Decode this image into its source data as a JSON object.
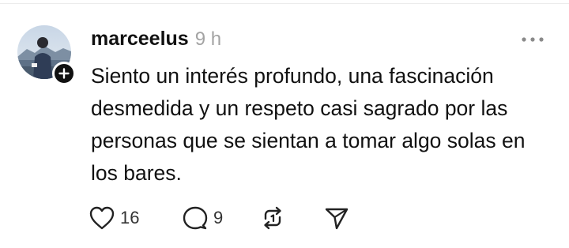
{
  "post": {
    "username": "marceelus",
    "time": "9 h",
    "text": "Siento un interés profundo, una fascinación desmedida y un respeto casi sagrado por las personas que se sientan a tomar algo solas en los bares.",
    "like_count": "16",
    "reply_count": "9"
  },
  "icons": {
    "avatar": "profile-photo",
    "follow": "plus-icon",
    "more": "more-icon",
    "like": "heart-icon",
    "reply": "comment-icon",
    "repost": "repost-icon",
    "share": "send-icon"
  },
  "colors": {
    "text": "#111111",
    "muted": "#a3a3a3",
    "badge": "#111111"
  }
}
